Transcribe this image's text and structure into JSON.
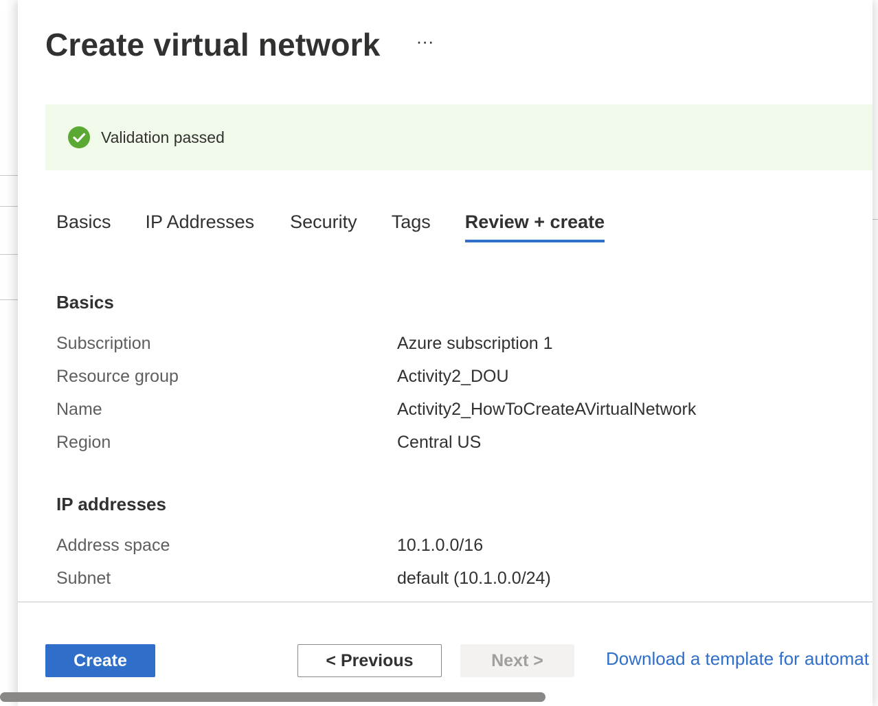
{
  "page": {
    "title": "Create virtual network",
    "more_label": "···"
  },
  "banner": {
    "text": "Validation passed",
    "icon": "check-circle-icon",
    "background": "#f1faea",
    "icon_color": "#5ba832"
  },
  "tabs": [
    {
      "label": "Basics",
      "active": false
    },
    {
      "label": "IP Addresses",
      "active": false
    },
    {
      "label": "Security",
      "active": false
    },
    {
      "label": "Tags",
      "active": false
    },
    {
      "label": "Review + create",
      "active": true
    }
  ],
  "sections": [
    {
      "heading": "Basics",
      "rows": [
        {
          "label": "Subscription",
          "value": "Azure subscription 1"
        },
        {
          "label": "Resource group",
          "value": "Activity2_DOU"
        },
        {
          "label": "Name",
          "value": "Activity2_HowToCreateAVirtualNetwork"
        },
        {
          "label": "Region",
          "value": "Central US"
        }
      ]
    },
    {
      "heading": "IP addresses",
      "rows": [
        {
          "label": "Address space",
          "value": "10.1.0.0/16"
        },
        {
          "label": "Subnet",
          "value": "default (10.1.0.0/24)"
        }
      ]
    }
  ],
  "footer": {
    "create_label": "Create",
    "previous_label": "< Previous",
    "next_label": "Next >",
    "download_link": "Download a template for automat"
  },
  "colors": {
    "accent": "#2f6fc9",
    "text": "#323130",
    "label": "#605e5c"
  }
}
